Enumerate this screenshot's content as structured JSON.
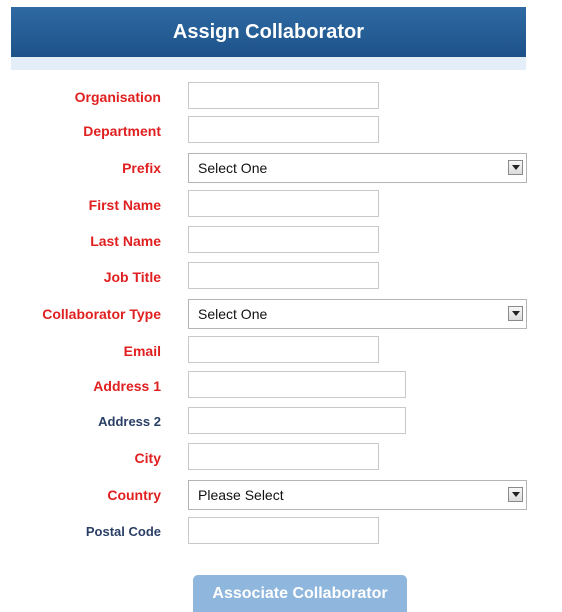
{
  "header": {
    "title": "Assign Collaborator"
  },
  "form": {
    "organisation": {
      "label": "Organisation",
      "value": ""
    },
    "department": {
      "label": "Department",
      "value": ""
    },
    "prefix": {
      "label": "Prefix",
      "selected": "Select One"
    },
    "first_name": {
      "label": "First Name",
      "value": ""
    },
    "last_name": {
      "label": "Last Name",
      "value": ""
    },
    "job_title": {
      "label": "Job Title",
      "value": ""
    },
    "collaborator_type": {
      "label": "Collaborator Type",
      "selected": "Select One"
    },
    "email": {
      "label": "Email",
      "value": ""
    },
    "address1": {
      "label": "Address 1",
      "value": ""
    },
    "address2": {
      "label": "Address 2",
      "value": ""
    },
    "city": {
      "label": "City",
      "value": ""
    },
    "country": {
      "label": "Country",
      "selected": "Please Select"
    },
    "postal_code": {
      "label": "Postal Code",
      "value": ""
    }
  },
  "actions": {
    "submit_label": "Associate Collaborator"
  },
  "colors": {
    "header_bg": "#1d5289",
    "required_label": "#e02020",
    "optional_label": "#2a3f66",
    "button_bg": "#8fb6dd"
  }
}
